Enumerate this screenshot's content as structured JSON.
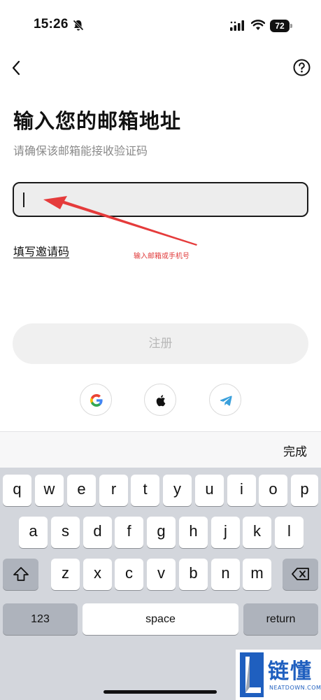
{
  "status_bar": {
    "time": "15:26",
    "battery": "72"
  },
  "nav": {
    "back_icon": "chevron-left-icon",
    "help_icon": "question-circle-icon"
  },
  "page": {
    "title": "输入您的邮箱地址",
    "subtitle": "请确保该邮箱能接收验证码"
  },
  "email_input": {
    "value": "",
    "placeholder": ""
  },
  "annotation": {
    "text": "输入邮箱或手机号",
    "color": "#e03a3a"
  },
  "invite_link": "填写邀请码",
  "register_button": "注册",
  "social_login": [
    {
      "name": "google",
      "icon": "google-icon"
    },
    {
      "name": "apple",
      "icon": "apple-icon"
    },
    {
      "name": "telegram",
      "icon": "telegram-icon"
    }
  ],
  "keyboard": {
    "done": "完成",
    "row1": [
      "q",
      "w",
      "e",
      "r",
      "t",
      "y",
      "u",
      "i",
      "o",
      "p"
    ],
    "row2": [
      "a",
      "s",
      "d",
      "f",
      "g",
      "h",
      "j",
      "k",
      "l"
    ],
    "row3": [
      "z",
      "x",
      "c",
      "v",
      "b",
      "n",
      "m"
    ],
    "numbers_key": "123",
    "space_key": "space",
    "return_key": "return"
  },
  "watermark": {
    "brand": "链懂",
    "domain": "NEATDOWN.COM"
  }
}
